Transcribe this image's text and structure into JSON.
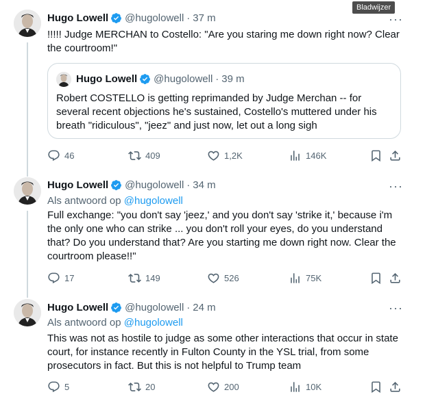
{
  "tooltip": "Bladwijzer",
  "tweets": [
    {
      "name": "Hugo Lowell",
      "handle": "@hugolowell",
      "time": "37 m",
      "text": "!!!!! Judge MERCHAN to Costello: \"Are you staring me down right now? Clear the courtroom!\"",
      "quote": {
        "name": "Hugo Lowell",
        "handle": "@hugolowell",
        "time": "39 m",
        "text": "Robert COSTELLO is getting reprimanded by Judge Merchan -- for several recent objections he's sustained, Costello's muttered under his breath \"ridiculous\", \"jeez\" and just now, let out a long sigh"
      },
      "replies": "46",
      "reposts": "409",
      "likes": "1,2K",
      "views": "146K"
    },
    {
      "name": "Hugo Lowell",
      "handle": "@hugolowell",
      "time": "34 m",
      "reply_prefix": "Als antwoord op",
      "reply_to": "@hugolowell",
      "text": "Full exchange: \"you don't say 'jeez,' and you don't say 'strike it,' because i'm the only one who can strike ... you don't roll your eyes, do you understand that? Do you understand that? Are you starting me down right now. Clear the courtroom please!!\"",
      "replies": "17",
      "reposts": "149",
      "likes": "526",
      "views": "75K"
    },
    {
      "name": "Hugo Lowell",
      "handle": "@hugolowell",
      "time": "24 m",
      "reply_prefix": "Als antwoord op",
      "reply_to": "@hugolowell",
      "text": "This was not as hostile to judge as some other interactions that occur in state court, for instance recently in Fulton County in the YSL trial, from some prosecutors in fact. But this is not helpful to Trump team",
      "replies": "5",
      "reposts": "20",
      "likes": "200",
      "views": "10K"
    }
  ],
  "colors": {
    "text": "#0f1419",
    "secondary": "#536471",
    "link": "#1d9bf0",
    "verified": "#1d9bf0",
    "border": "#cfd9de"
  },
  "icons": [
    "verified-badge-icon",
    "reply-icon",
    "repost-icon",
    "like-icon",
    "views-icon",
    "bookmark-icon",
    "share-icon",
    "more-icon"
  ]
}
